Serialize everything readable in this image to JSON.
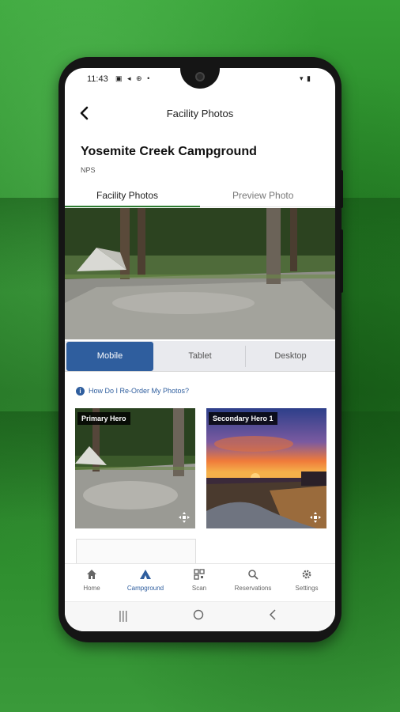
{
  "status_bar": {
    "time": "11:43",
    "left_icons": "▣ ◂ ⊕ •",
    "right_icons": "▾ ▮"
  },
  "header": {
    "back_icon": "chevron-left",
    "title": "Facility Photos"
  },
  "campground": {
    "name": "Yosemite Creek Campground",
    "subtitle": "NPS"
  },
  "tabs": [
    {
      "label": "Facility Photos",
      "active": true
    },
    {
      "label": "Preview Photo",
      "active": false
    }
  ],
  "device_toggle": [
    {
      "label": "Mobile",
      "active": true
    },
    {
      "label": "Tablet",
      "active": false
    },
    {
      "label": "Desktop",
      "active": false
    }
  ],
  "help_link": "How Do I Re-Order My Photos?",
  "photo_cards": [
    {
      "label": "Primary Hero",
      "image": "campsite-photo"
    },
    {
      "label": "Secondary Hero 1",
      "image": "sunset-photo"
    }
  ],
  "bottom_nav": [
    {
      "label": "Home",
      "icon": "home-icon",
      "active": false
    },
    {
      "label": "Campground",
      "icon": "tent-icon",
      "active": true
    },
    {
      "label": "Scan",
      "icon": "qr-icon",
      "active": false
    },
    {
      "label": "Reservations",
      "icon": "search-icon",
      "active": false
    },
    {
      "label": "Settings",
      "icon": "gear-icon",
      "active": false
    }
  ],
  "colors": {
    "accent_blue": "#2f5e9e",
    "tab_underline_green": "#2e7d32",
    "background_green": "#2e8a2e"
  }
}
